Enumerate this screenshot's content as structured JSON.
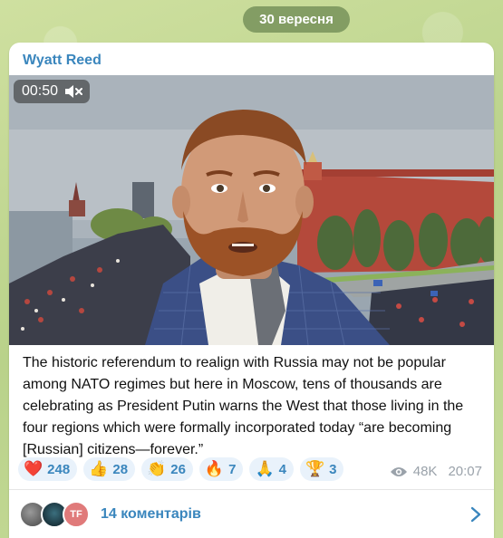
{
  "date_label": "30 вересня",
  "post": {
    "author": "Wyatt Reed",
    "video": {
      "duration": "00:50",
      "muted_icon": "speaker-muted-icon"
    },
    "caption": "The historic referendum to realign with Russia may not be popular among NATO regimes but here in Moscow, tens of thousands are celebrating as President Putin warns the West that those living in the four regions which were formally incorporated today “are becoming [Russian] citizens—forever.”",
    "reactions": [
      {
        "emoji": "❤️",
        "count": "248"
      },
      {
        "emoji": "👍",
        "count": "28"
      },
      {
        "emoji": "👏",
        "count": "26"
      },
      {
        "emoji": "🔥",
        "count": "7"
      },
      {
        "emoji": "🙏",
        "count": "4"
      },
      {
        "emoji": "🏆",
        "count": "3"
      }
    ],
    "views": "48K",
    "time": "20:07",
    "comments": {
      "avatar_initials": "TF",
      "label": "14 коментарів"
    }
  },
  "colors": {
    "accent": "#3a86bd",
    "reaction_bg": "#e9f2fb",
    "wall": "#b44a3c"
  }
}
